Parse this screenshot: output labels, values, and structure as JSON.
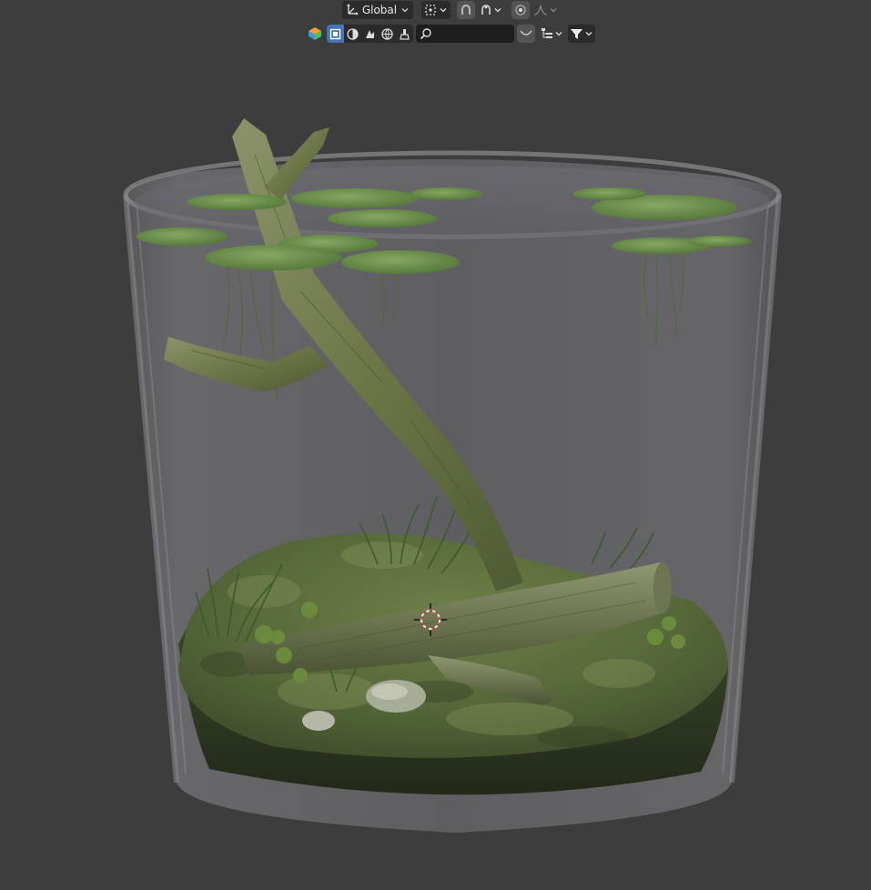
{
  "header": {
    "transform_orientation": {
      "label": "Global",
      "icon": "orientation-gizmo-icon"
    },
    "pivot_point_icon": "pivot-point-icon",
    "snap_icon": "snap-magnet-icon",
    "proportional_edit_icon": "proportional-edit-icon",
    "falloff_icon": "falloff-curve-icon"
  },
  "outliner_header": {
    "display_mode_icon": "display-mode-icon",
    "filter_icons": [
      "object-select-icon",
      "viewport-shading-icon",
      "render-icon",
      "world-icon",
      "brush-icon"
    ],
    "search": {
      "value": "",
      "placeholder": ""
    },
    "filter_icon": "funnel-filter-icon"
  },
  "colors": {
    "viewport_bg": "#3d3d3d",
    "header_button_bg": "#2b2b2b",
    "active_blue": "#4772b3",
    "search_bg": "#1e1e1e",
    "moss_green": "#5c6e3c",
    "bark": "#7f875a"
  },
  "scene": {
    "objects": [
      "glass-jar",
      "water-surface",
      "lily-pads",
      "branch",
      "log",
      "moss-base",
      "grass",
      "stones",
      "clover"
    ],
    "cursor": "3d-cursor"
  }
}
